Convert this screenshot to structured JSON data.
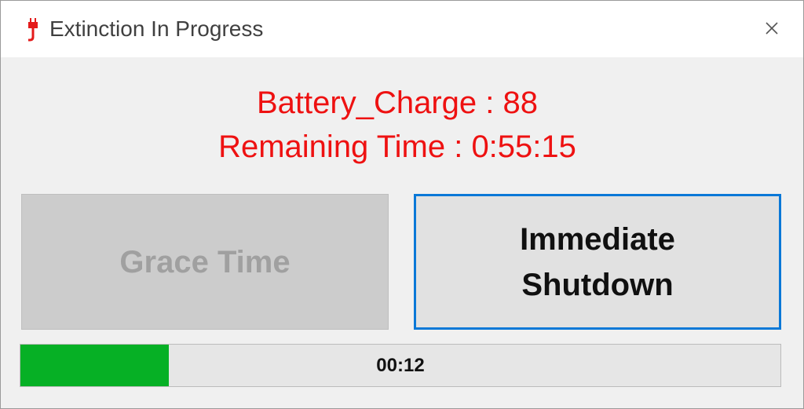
{
  "window": {
    "title": "Extinction In Progress",
    "icon": "power-plug-icon",
    "close_icon": "close-icon"
  },
  "status": {
    "battery_line": "Battery_Charge : 88",
    "remaining_line": "Remaining Time : 0:55:15",
    "color": "#ee1111"
  },
  "buttons": {
    "grace_label": "Grace Time",
    "grace_enabled": false,
    "shutdown_label_line1": "Immediate",
    "shutdown_label_line2": "Shutdown",
    "focus_color": "#0a78d7"
  },
  "progress": {
    "value_fraction": 0.195,
    "text": "00:12",
    "fill_color": "#06b025"
  }
}
